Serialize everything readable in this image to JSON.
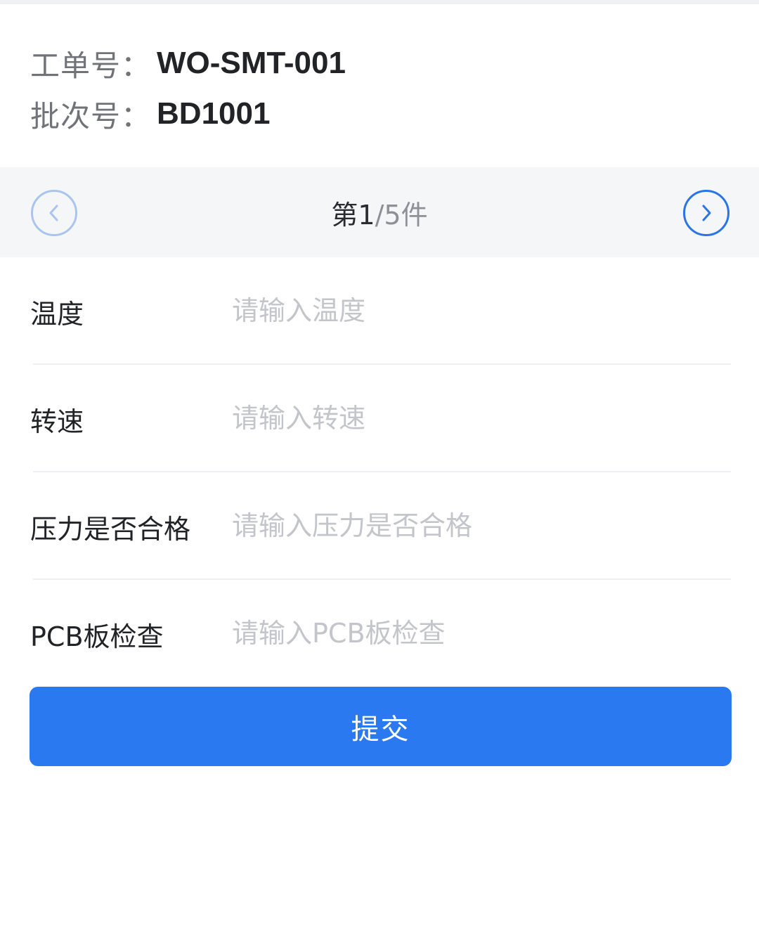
{
  "header": {
    "work_order_label": "工单号：",
    "work_order_value": "WO-SMT-001",
    "batch_label": "批次号：",
    "batch_value": "BD1001"
  },
  "pager": {
    "current_text": "第1",
    "total_text": "/5件",
    "current": 1,
    "total": 5,
    "prev_icon": "chevron-left-icon",
    "next_icon": "chevron-right-icon",
    "prev_enabled": false,
    "next_enabled": true
  },
  "form": {
    "fields": [
      {
        "label": "温度",
        "value": "",
        "placeholder": "请输入温度"
      },
      {
        "label": "转速",
        "value": "",
        "placeholder": "请输入转速"
      },
      {
        "label": "压力是否合格",
        "value": "",
        "placeholder": "请输入压力是否合格"
      },
      {
        "label": "PCB板检查",
        "value": "",
        "placeholder": "请输入PCB板检查"
      }
    ]
  },
  "actions": {
    "submit_label": "提交"
  },
  "colors": {
    "primary": "#2a79f0",
    "disabled_icon": "#a9c5ee",
    "placeholder": "#c3c5ca",
    "pager_bg": "#f5f6f8"
  }
}
